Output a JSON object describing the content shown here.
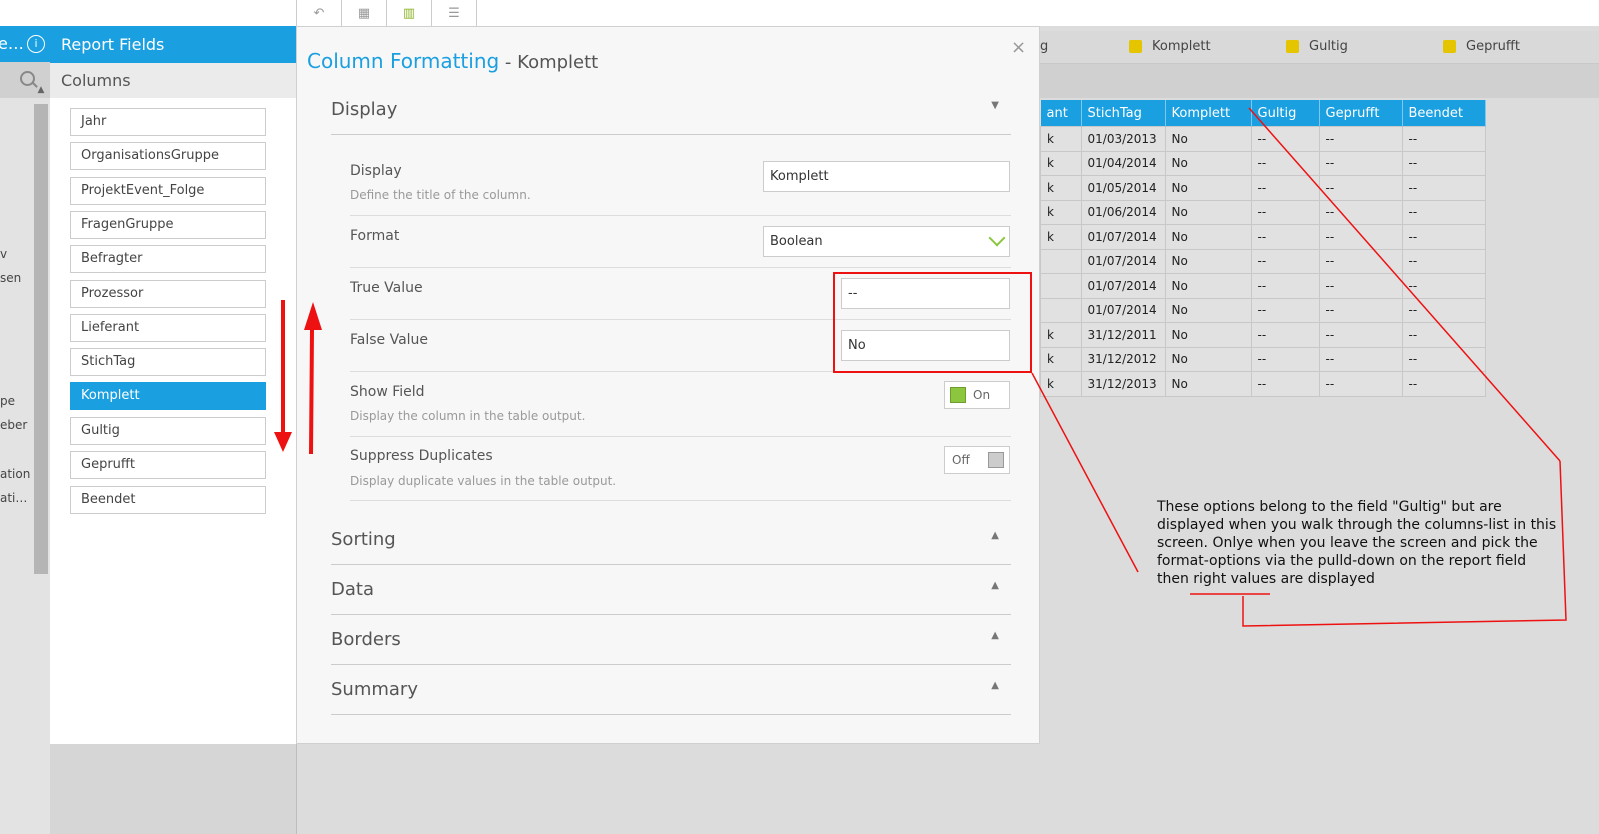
{
  "far_left": {
    "title": "e…",
    "info_icon": "i",
    "side_texts": [
      "v",
      "sen",
      "pe",
      "eber",
      "ation",
      "ati…"
    ]
  },
  "toolbar": {
    "buttons": [
      "undo-icon",
      "table-icon",
      "layout-icon",
      "list-icon"
    ]
  },
  "report_fields": {
    "title": "Report Fields",
    "columns_label": "Columns",
    "items": [
      "Jahr",
      "OrganisationsGruppe",
      "ProjektEvent_Folge",
      "FragenGruppe",
      "Befragter",
      "Prozessor",
      "Lieferant",
      "StichTag",
      "Komplett",
      "Gultig",
      "Geprufft",
      "Beendet"
    ],
    "selected": "Komplett"
  },
  "modal": {
    "title": "Column Formatting",
    "title_sep": " - ",
    "subtitle": "Komplett",
    "close_icon": "×",
    "display_section": {
      "label": "Display",
      "display_field": {
        "label": "Display",
        "desc": "Define the title of the column.",
        "value": "Komplett"
      },
      "format_field": {
        "label": "Format",
        "value": "Boolean"
      },
      "true_value": {
        "label": "True Value",
        "value": "--"
      },
      "false_value": {
        "label": "False Value",
        "value": "No"
      },
      "show_field": {
        "label": "Show Field",
        "desc": "Display the column in the table output.",
        "toggle": "On"
      },
      "suppress": {
        "label": "Suppress Duplicates",
        "desc": "Display duplicate values in the table output.",
        "toggle": "Off"
      }
    },
    "sections": [
      "Sorting",
      "Data",
      "Borders",
      "Summary"
    ]
  },
  "legend": {
    "partial": "g",
    "items": [
      "Komplett",
      "Gultig",
      "Geprufft"
    ],
    "color": "#e5c400"
  },
  "table": {
    "headers": [
      "ant",
      "StichTag",
      "Komplett",
      "Gultig",
      "Geprufft",
      "Beendet"
    ],
    "rows": [
      [
        "k",
        "01/03/2013",
        "No",
        "--",
        "--",
        "--"
      ],
      [
        "k",
        "01/04/2014",
        "No",
        "--",
        "--",
        "--"
      ],
      [
        "k",
        "01/05/2014",
        "No",
        "--",
        "--",
        "--"
      ],
      [
        "k",
        "01/06/2014",
        "No",
        "--",
        "--",
        "--"
      ],
      [
        "k",
        "01/07/2014",
        "No",
        "--",
        "--",
        "--"
      ],
      [
        "",
        "01/07/2014",
        "No",
        "--",
        "--",
        "--"
      ],
      [
        "",
        "01/07/2014",
        "No",
        "--",
        "--",
        "--"
      ],
      [
        "",
        "01/07/2014",
        "No",
        "--",
        "--",
        "--"
      ],
      [
        "k",
        "31/12/2011",
        "No",
        "--",
        "--",
        "--"
      ],
      [
        "k",
        "31/12/2012",
        "No",
        "--",
        "--",
        "--"
      ],
      [
        "k",
        "31/12/2013",
        "No",
        "--",
        "--",
        "--"
      ]
    ]
  },
  "annotation": {
    "note": "These options belong to the field \"Gultig\" but are displayed when you walk through the columns-list in this screen. Onlye when  you leave the screen and pick the format-options via the pulld-down on the report field then right values are displayed",
    "color": "#e11111"
  },
  "colors": {
    "accent": "#1a9fe0",
    "green": "#8cc63f"
  }
}
